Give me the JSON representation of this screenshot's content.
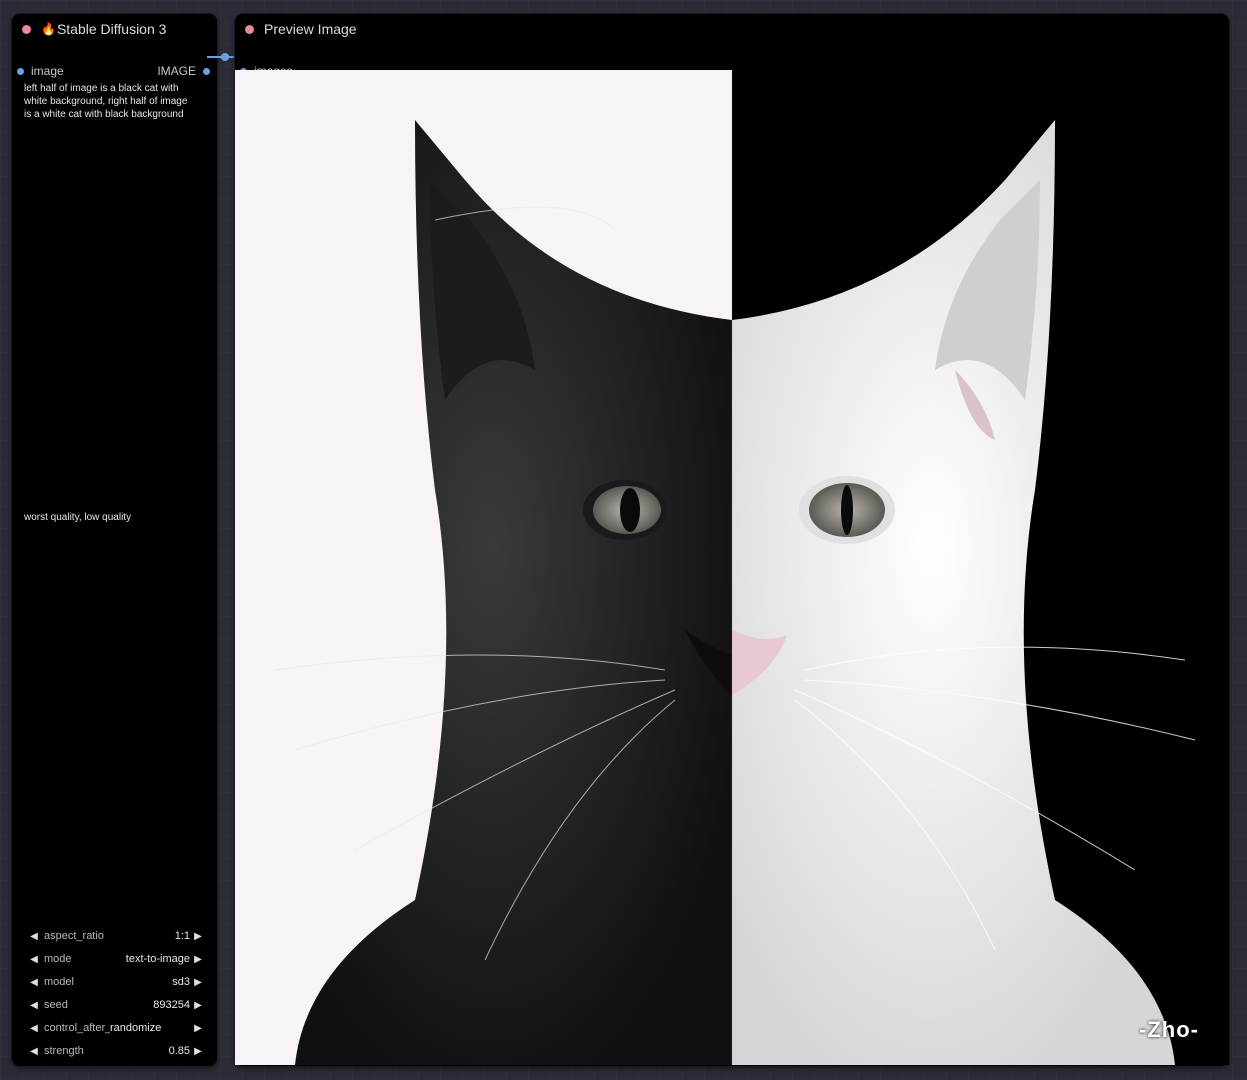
{
  "sd3_node": {
    "title": "Stable Diffusion 3",
    "output_slot_label": "image",
    "output_slot_type": "IMAGE",
    "positive_prompt": "left half of image is a black cat with\nwhite background, right half of image\nis a white cat with black background",
    "negative_prompt": "worst quality, low quality",
    "widgets": [
      {
        "name": "aspect_ratio",
        "value": "1:1"
      },
      {
        "name": "mode",
        "value": "text-to-image"
      },
      {
        "name": "model",
        "value": "sd3"
      },
      {
        "name": "seed",
        "value": "893254"
      },
      {
        "name": "control_after_generate",
        "value": "randomize"
      },
      {
        "name": "strength",
        "value": "0.85"
      }
    ]
  },
  "preview_node": {
    "title": "Preview Image",
    "input_slot_label": "images"
  },
  "image": {
    "description_icon": "cat-image",
    "watermark": "-Zho-"
  },
  "colors": {
    "title_dot": "#e88a9a",
    "slot_dot": "#6ea0e8",
    "canvas_bg": "#2b2c36"
  }
}
